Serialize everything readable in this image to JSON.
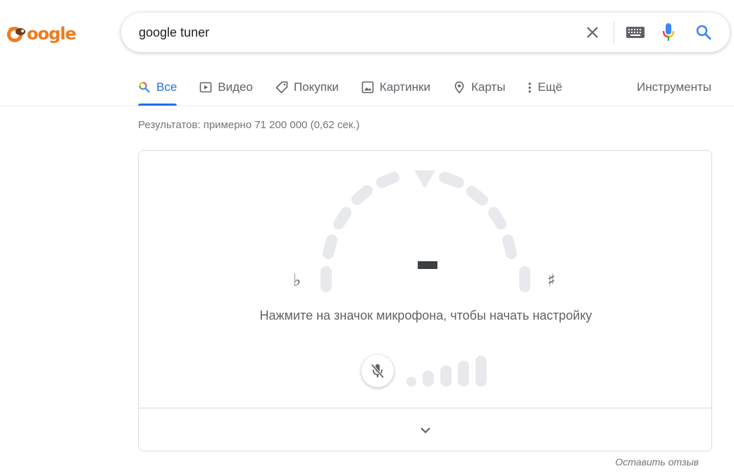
{
  "logo": {
    "text": "oogle"
  },
  "search": {
    "query": "google tuner"
  },
  "tabs": [
    {
      "label": "Все",
      "icon": "search-icon"
    },
    {
      "label": "Видео",
      "icon": "video-icon"
    },
    {
      "label": "Покупки",
      "icon": "tag-icon"
    },
    {
      "label": "Картинки",
      "icon": "image-icon"
    },
    {
      "label": "Карты",
      "icon": "map-pin-icon"
    },
    {
      "label": "Ещё",
      "icon": "more-vert-icon"
    }
  ],
  "tools_label": "Инструменты",
  "result_stats": "Результатов: примерно 71 200 000 (0,62 сек.)",
  "tuner": {
    "flat_symbol": "♭",
    "sharp_symbol": "♯",
    "instruction": "Нажмите на значок микрофона, чтобы начать настройку",
    "mic_muted": true
  },
  "feedback_label": "Оставить отзыв",
  "colors": {
    "accent": "#1a73e8",
    "logo_orange": "#f07b1d",
    "dial_gray": "#e8e9ec"
  }
}
